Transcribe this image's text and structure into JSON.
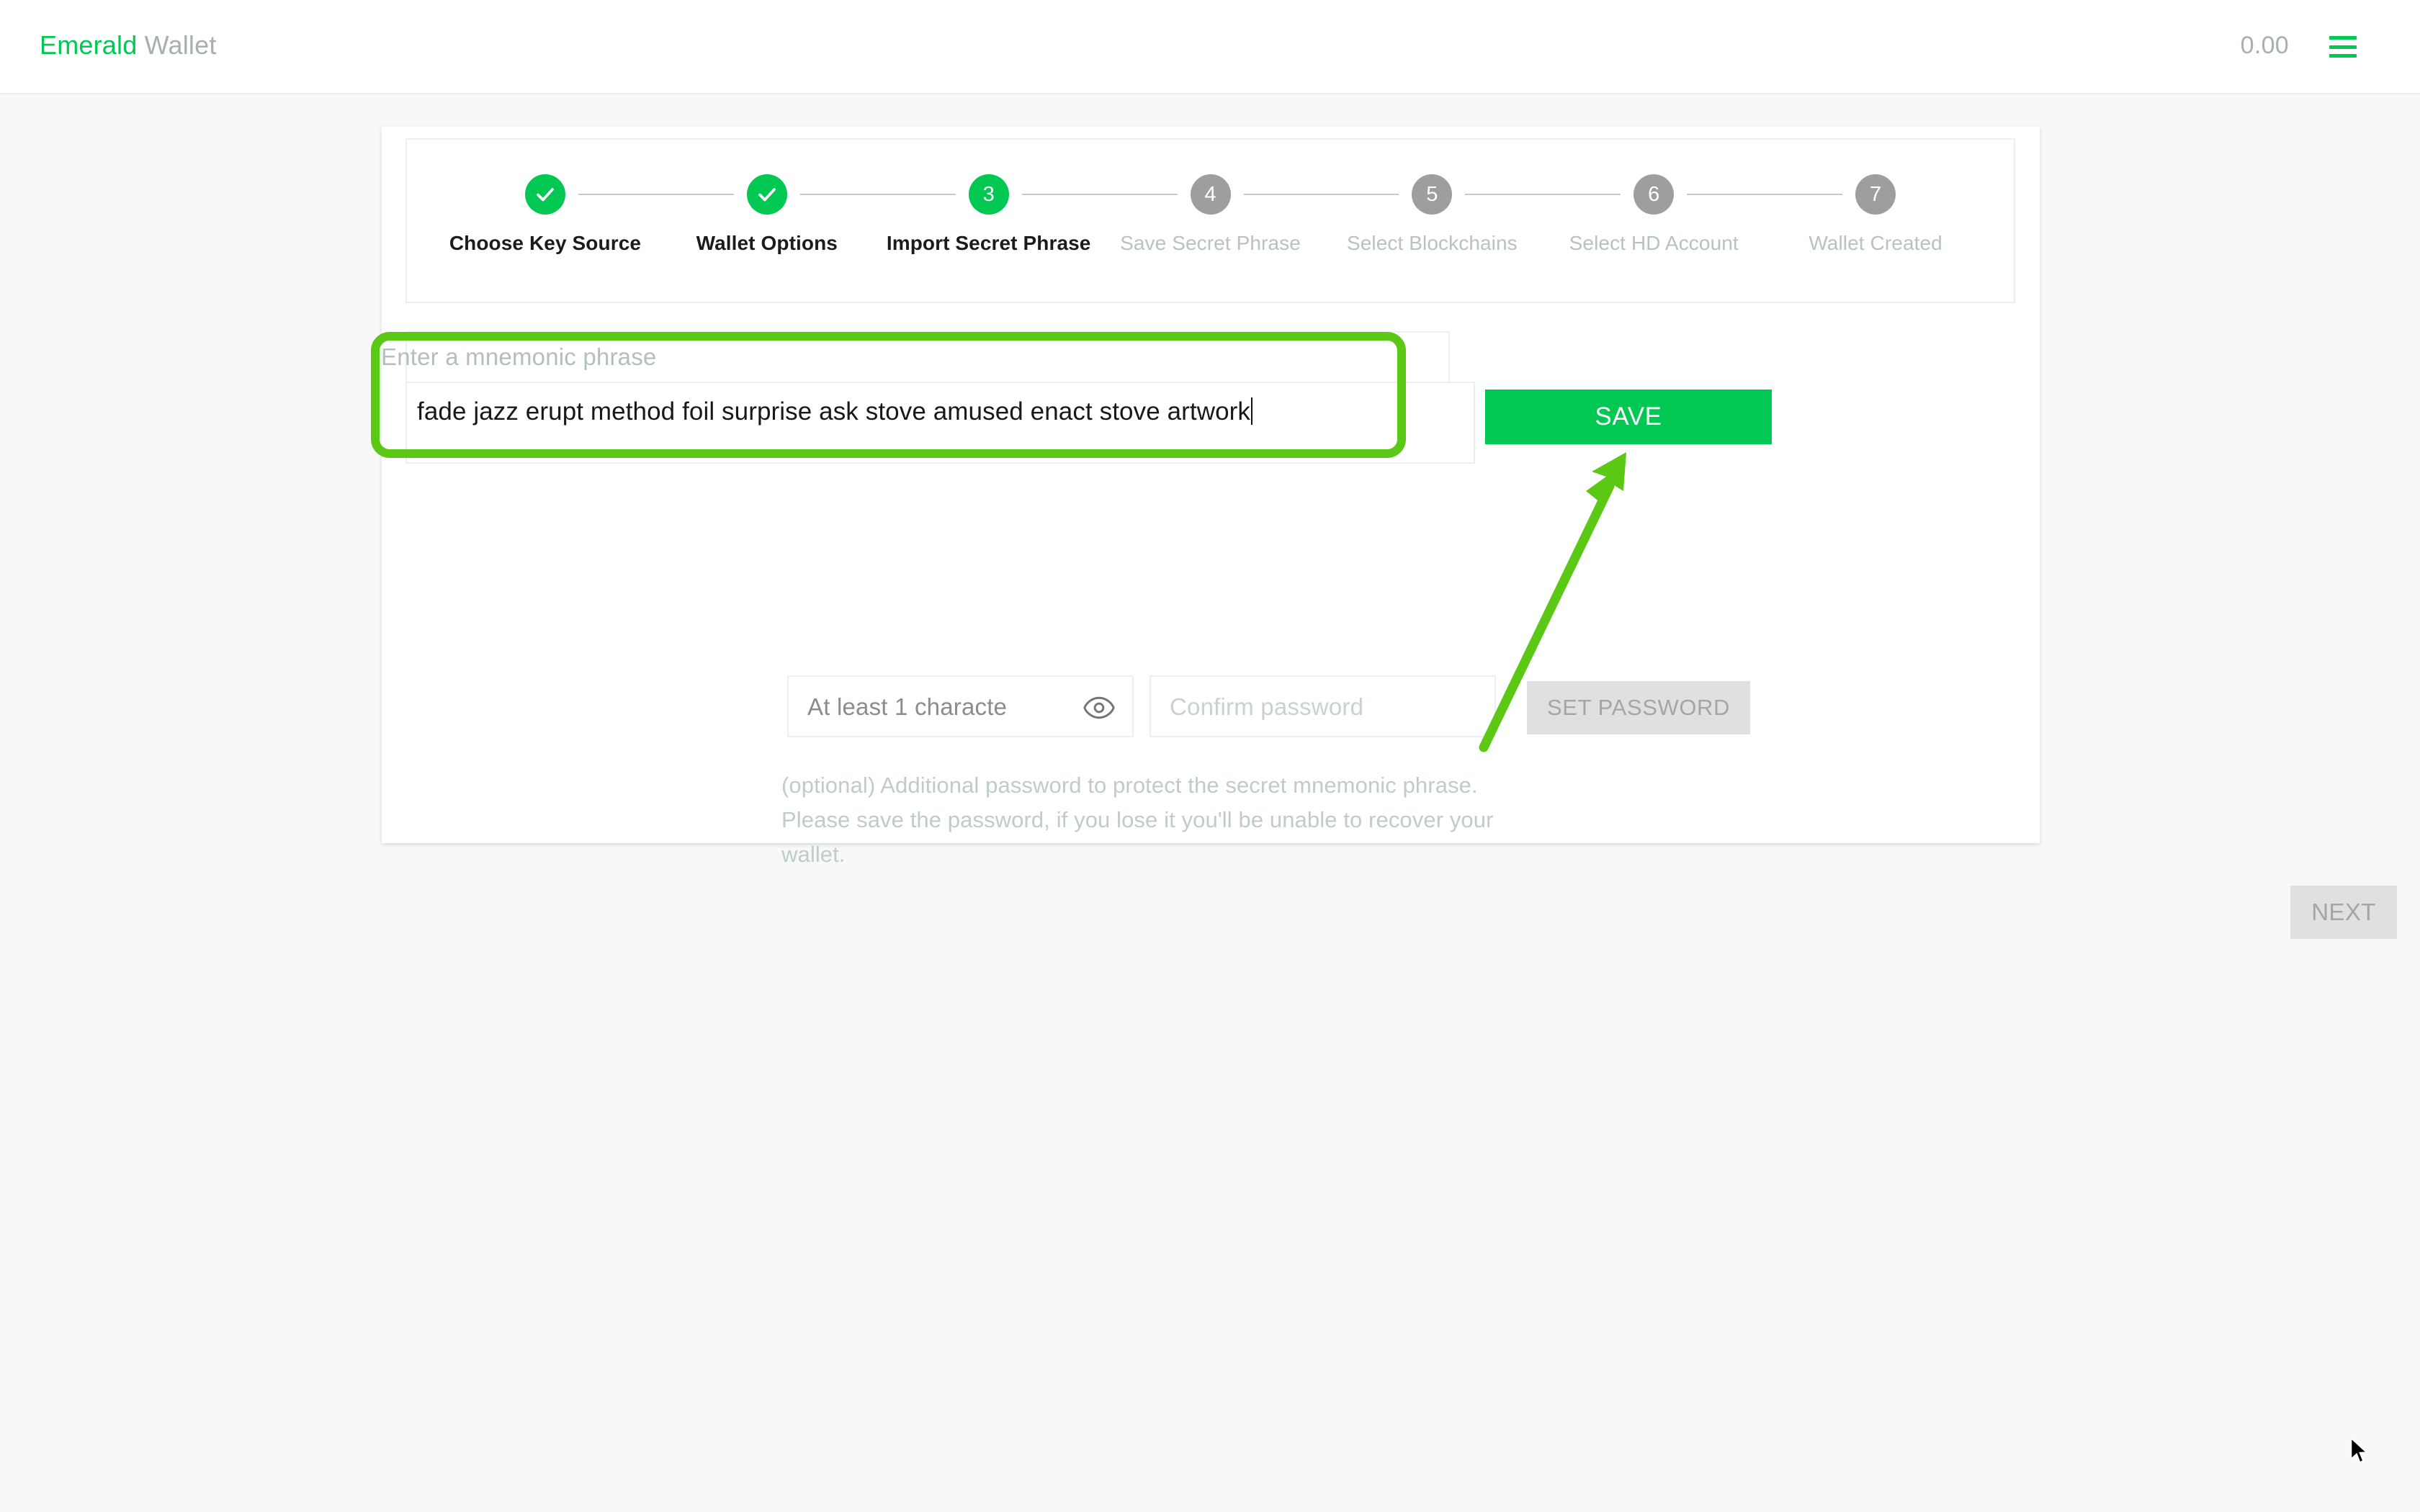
{
  "header": {
    "brand_primary": "Emerald",
    "brand_secondary": "Wallet",
    "balance": "0.00",
    "menu_icon": "hamburger-menu-icon",
    "brand_color": "#00c853"
  },
  "stepper": {
    "steps": [
      {
        "number": "1",
        "label": "Choose Key Source",
        "state": "done"
      },
      {
        "number": "2",
        "label": "Wallet Options",
        "state": "done"
      },
      {
        "number": "3",
        "label": "Import Secret Phrase",
        "state": "active"
      },
      {
        "number": "4",
        "label": "Save Secret Phrase",
        "state": "todo"
      },
      {
        "number": "5",
        "label": "Select Blockchains",
        "state": "todo"
      },
      {
        "number": "6",
        "label": "Select HD Account",
        "state": "todo"
      },
      {
        "number": "7",
        "label": "Wallet Created",
        "state": "todo"
      }
    ]
  },
  "mnemonic": {
    "label": "Enter a mnemonic phrase",
    "value": "fade jazz erupt method foil surprise ask stove amused enact stove artwork",
    "save_label": "SAVE"
  },
  "password": {
    "password_placeholder": "At least 1 characte",
    "confirm_placeholder": "Confirm password",
    "set_password_label": "SET PASSWORD",
    "reveal_icon": "eye-icon",
    "helper": "(optional) Additional password to protect the secret mnemonic phrase. Please save the password, if you lose it you'll be unable to recover your wallet."
  },
  "footer": {
    "next_label": "NEXT"
  },
  "annotation": {
    "highlight_color": "#5bc816",
    "arrow_color": "#5bc816",
    "arrow_target": "save-button"
  }
}
